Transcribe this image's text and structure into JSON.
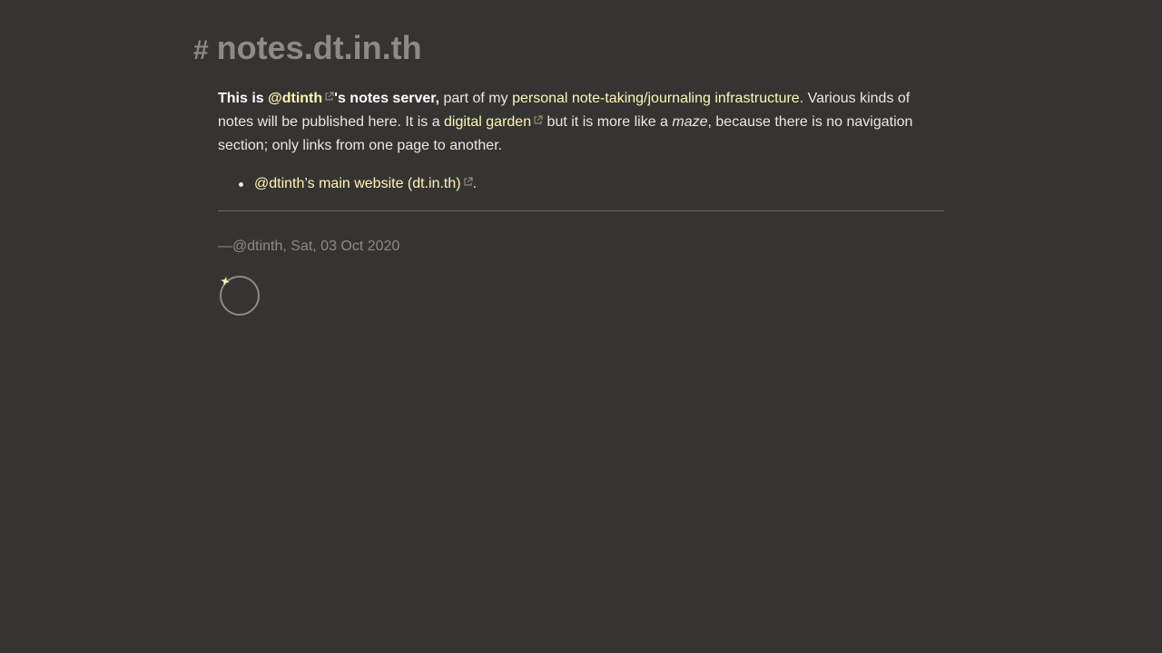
{
  "page": {
    "hash": "#",
    "title": "notes.dt.in.th"
  },
  "intro": {
    "bold_prefix": "This is ",
    "author_link": "@dtinth",
    "bold_suffix": "'s notes server,",
    "text1": " part of my ",
    "infra_link": "personal note-taking/journaling infrastructure",
    "text2": ". Various kinds of notes will be published here. It is a ",
    "garden_link": "digital garden",
    "text3": " but it is more like a ",
    "maze": "maze",
    "text4": ", because there is no navigation section; only links from one page to another."
  },
  "links": [
    {
      "label": "@dtinth’s main website (dt.in.th)",
      "after": "."
    }
  ],
  "footer": {
    "signature": "—@dtinth, Sat, 03 Oct 2020"
  },
  "colors": {
    "background": "#353432",
    "link": "#fff6b3",
    "muted": "#8d8b84"
  },
  "icons": [
    "external-link-icon",
    "sparkle-spinner-icon"
  ]
}
